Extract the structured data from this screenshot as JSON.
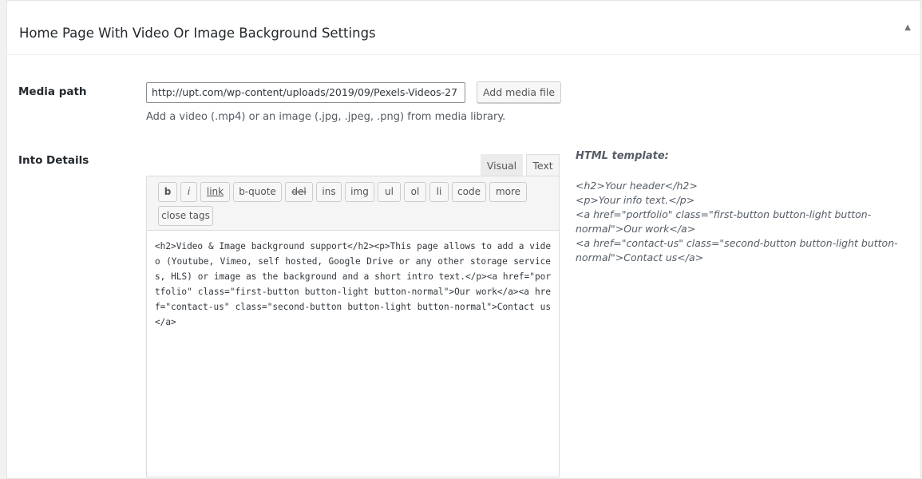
{
  "metabox": {
    "title": "Home Page With Video Or Image Background Settings",
    "toggle_icon": "triangle-up-icon",
    "toggle_glyph": "▲"
  },
  "media": {
    "label": "Media path",
    "url_value": "http://upt.com/wp-content/uploads/2019/09/Pexels-Videos-27",
    "add_button": "Add media file",
    "description": "Add a video (.mp4) or an image (.jpg, .jpeg, .png) from media library."
  },
  "details": {
    "label": "Into Details",
    "tabs": {
      "visual": "Visual",
      "text": "Text",
      "active": "Text"
    },
    "quicktags": [
      "b",
      "i",
      "link",
      "b-quote",
      "del",
      "ins",
      "img",
      "ul",
      "ol",
      "li",
      "code",
      "more",
      "close tags"
    ],
    "content": "<h2>Video & Image background support</h2><p>This page allows to add a video (Youtube, Vimeo, self hosted, Google Drive or any other storage services, HLS) or image as the background and a short intro text.</p><a href=\"portfolio\" class=\"first-button button-light button-normal\">Our work</a><a href=\"contact-us\" class=\"second-button button-light button-normal\">Contact us</a>"
  },
  "template": {
    "heading": "HTML template:",
    "lines": [
      "<h2>Your header</h2>",
      "<p>Your info text.</p>",
      "<a href=\"portfolio\" class=\"first-button button-light button-",
      "normal\">Our work</a>",
      "<a href=\"contact-us\" class=\"second-button button-light button-",
      "normal\">Contact us</a>"
    ]
  },
  "colors": {
    "background": "#f1f1f1",
    "panel": "#ffffff",
    "border": "#dcdcde",
    "text": "#23282d",
    "muted_text": "#555d66"
  }
}
